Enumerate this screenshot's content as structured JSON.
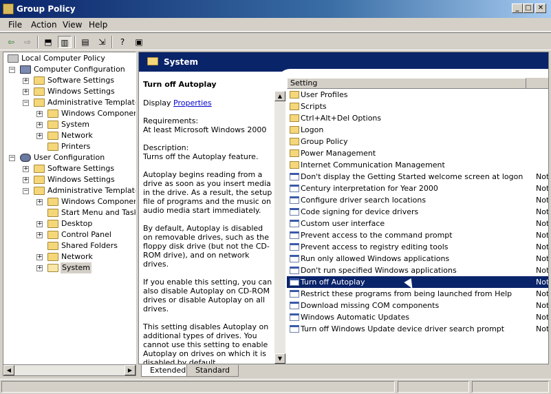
{
  "window": {
    "title": "Group Policy"
  },
  "menu": [
    "File",
    "Action",
    "View",
    "Help"
  ],
  "tree": {
    "root": "Local Computer Policy",
    "computer_config": "Computer Configuration",
    "user_config": "User Configuration",
    "computer_children": [
      "Software Settings",
      "Windows Settings",
      "Administrative Templates"
    ],
    "computer_admin_children": [
      "Windows Components",
      "System",
      "Network",
      "Printers"
    ],
    "user_children": [
      "Software Settings",
      "Windows Settings",
      "Administrative Templates"
    ],
    "user_admin_children": [
      "Windows Components",
      "Start Menu and Taskba",
      "Desktop",
      "Control Panel",
      "Shared Folders",
      "Network",
      "System"
    ]
  },
  "panel": {
    "header_title": "System"
  },
  "description": {
    "title": "Turn off Autoplay",
    "display_prefix": "Display",
    "properties_link": "Properties",
    "requirements_label": "Requirements:",
    "requirements_text": "At least Microsoft Windows 2000",
    "description_label": "Description:",
    "description_text": "Turns off the Autoplay feature.",
    "para1": "Autoplay begins reading from a drive as soon as you insert media in the drive. As a result, the setup file of programs and the music on audio media start immediately.",
    "para2": "By default, Autoplay is disabled on removable drives, such as the floppy disk drive (but not the CD-ROM drive), and on network drives.",
    "para3": "If you enable this setting, you can also disable Autoplay on CD-ROM drives or disable Autoplay on all drives.",
    "para4": "This setting disables Autoplay on additional types of drives. You cannot use this setting to enable Autoplay on drives on which it is disabled by default."
  },
  "list": {
    "column_setting": "Setting",
    "folders": [
      "User Profiles",
      "Scripts",
      "Ctrl+Alt+Del Options",
      "Logon",
      "Group Policy",
      "Power Management",
      "Internet Communication Management"
    ],
    "settings": [
      {
        "name": "Don't display the Getting Started welcome screen at logon",
        "state": "Not"
      },
      {
        "name": "Century interpretation for Year 2000",
        "state": "Not"
      },
      {
        "name": "Configure driver search locations",
        "state": "Not"
      },
      {
        "name": "Code signing for device drivers",
        "state": "Not"
      },
      {
        "name": "Custom user interface",
        "state": "Not"
      },
      {
        "name": "Prevent access to the command prompt",
        "state": "Not"
      },
      {
        "name": "Prevent access to registry editing tools",
        "state": "Not"
      },
      {
        "name": "Run only allowed Windows applications",
        "state": "Not"
      },
      {
        "name": "Don't run specified Windows applications",
        "state": "Not"
      },
      {
        "name": "Turn off Autoplay",
        "state": "Not"
      },
      {
        "name": "Restrict these programs from being launched from Help",
        "state": "Not"
      },
      {
        "name": "Download missing COM components",
        "state": "Not"
      },
      {
        "name": "Windows Automatic Updates",
        "state": "Not"
      },
      {
        "name": "Turn off Windows Update device driver search prompt",
        "state": "Not"
      }
    ],
    "selected": "Turn off Autoplay"
  },
  "tabs": [
    "Extended",
    "Standard"
  ],
  "colors": {
    "selection": "#0a246a",
    "title_start": "#0a246a",
    "title_end": "#a6caf0",
    "link": "#0000cc"
  }
}
